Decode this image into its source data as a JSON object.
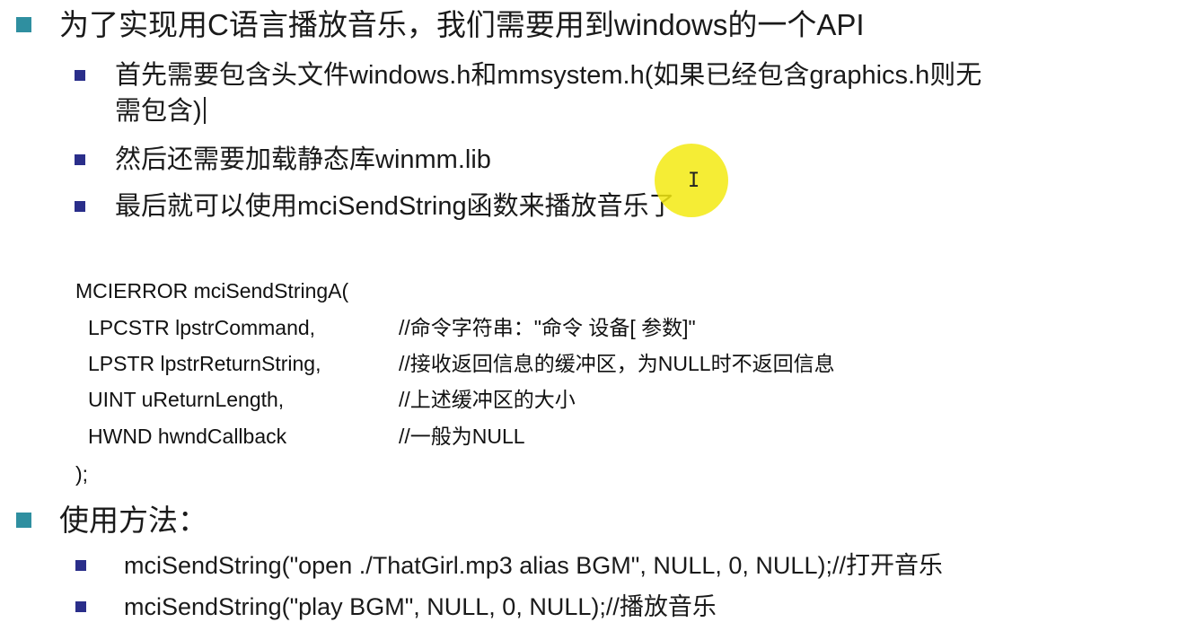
{
  "colors": {
    "level1_bullet": "#2f8fa0",
    "level2_bullet": "#2a2e8a",
    "cursor_highlight": "#f3ea12",
    "text": "#1a1a1a"
  },
  "bullets": {
    "intro": "为了实现用C语言播放音乐，我们需要用到windows的一个API",
    "include_line1": "首先需要包含头文件windows.h和mmsystem.h(如果已经包含graphics.h则无",
    "include_line2": "需包含)",
    "link_lib": "然后还需要加载静态库winmm.lib",
    "use_func": "最后就可以使用mciSendString函数来播放音乐了",
    "usage_heading": "使用方法："
  },
  "code": {
    "signature": "MCIERROR mciSendStringA(",
    "params": [
      {
        "decl": "LPCSTR lpstrCommand,",
        "comment": "//命令字符串：\"命令 设备[ 参数]\""
      },
      {
        "decl": "LPSTR lpstrReturnString,",
        "comment": "//接收返回信息的缓冲区，为NULL时不返回信息"
      },
      {
        "decl": "UINT uReturnLength,",
        "comment": "//上述缓冲区的大小"
      },
      {
        "decl": "HWND hwndCallback",
        "comment": "//一般为NULL"
      }
    ],
    "closing": ");"
  },
  "examples": [
    "mciSendString(\"open ./ThatGirl.mp3 alias BGM\", NULL, 0, NULL);//打开音乐",
    "mciSendString(\"play BGM\", NULL, 0, NULL);//播放音乐"
  ],
  "icons": {
    "cursor": "text-cursor-icon",
    "bullet_l1": "square-bullet-icon",
    "bullet_l2": "small-square-bullet-icon"
  }
}
